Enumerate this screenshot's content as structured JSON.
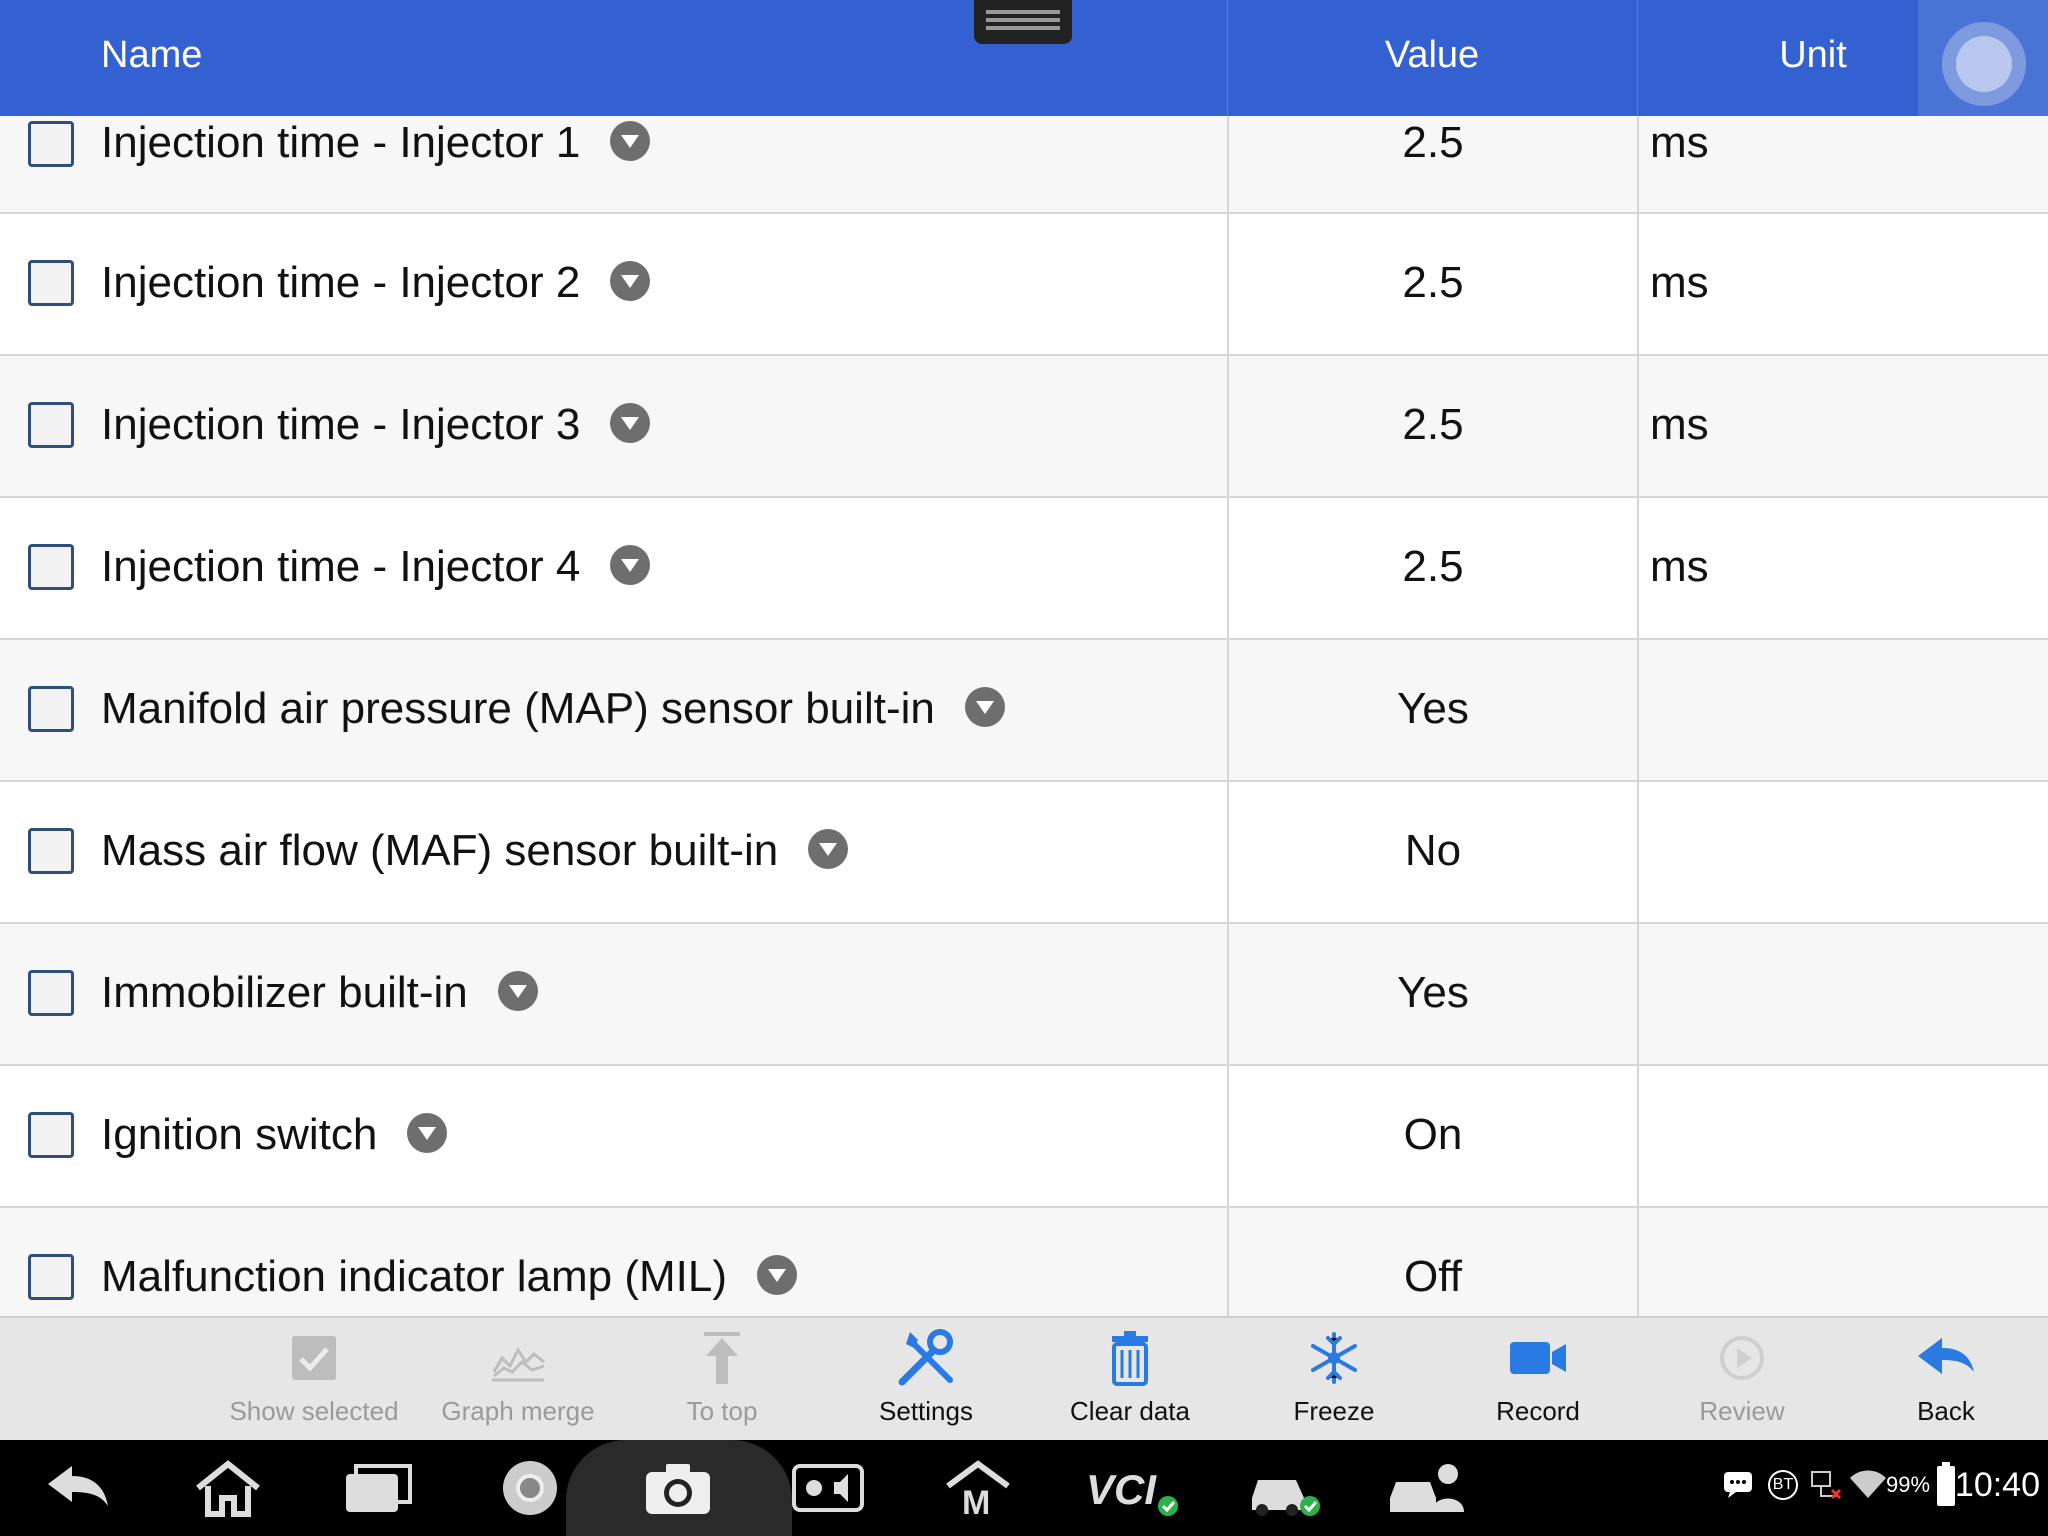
{
  "header": {
    "name_label": "Name",
    "value_label": "Value",
    "unit_label": "Unit"
  },
  "rows": [
    {
      "name": "Injection time - Injector 1",
      "value": "2.5",
      "unit": "ms",
      "checked": false
    },
    {
      "name": "Injection time - Injector 2",
      "value": "2.5",
      "unit": "ms",
      "checked": false
    },
    {
      "name": "Injection time - Injector 3",
      "value": "2.5",
      "unit": "ms",
      "checked": false
    },
    {
      "name": "Injection time - Injector 4",
      "value": "2.5",
      "unit": "ms",
      "checked": false
    },
    {
      "name": "Manifold air pressure (MAP) sensor built-in",
      "value": "Yes",
      "unit": "",
      "checked": false
    },
    {
      "name": "Mass air flow (MAF) sensor built-in",
      "value": "No",
      "unit": "",
      "checked": false
    },
    {
      "name": "Immobilizer built-in",
      "value": "Yes",
      "unit": "",
      "checked": false
    },
    {
      "name": "Ignition switch",
      "value": "On",
      "unit": "",
      "checked": false
    },
    {
      "name": "Malfunction indicator lamp (MIL)",
      "value": "Off",
      "unit": "",
      "checked": false
    }
  ],
  "toolbar": {
    "show_selected": "Show selected",
    "graph_merge": "Graph merge",
    "to_top": "To top",
    "settings": "Settings",
    "clear_data": "Clear data",
    "freeze": "Freeze",
    "record": "Record",
    "review": "Review",
    "back": "Back"
  },
  "navbar": {
    "icons": [
      "back-icon",
      "home-icon",
      "recent-apps-icon",
      "chrome-icon",
      "camera-icon",
      "brightness-volume-icon",
      "m-icon",
      "vci-icon",
      "car-icon",
      "car-user-icon"
    ],
    "vci_text": "VCI",
    "m_text": "M"
  },
  "status_bar": {
    "bt_label": "BT",
    "battery": "99%",
    "time": "10:40"
  },
  "colors": {
    "header_blue": "#3461d1",
    "toolbar_icon_blue": "#2a7ae4",
    "disabled_gray": "#9a9a9a"
  }
}
